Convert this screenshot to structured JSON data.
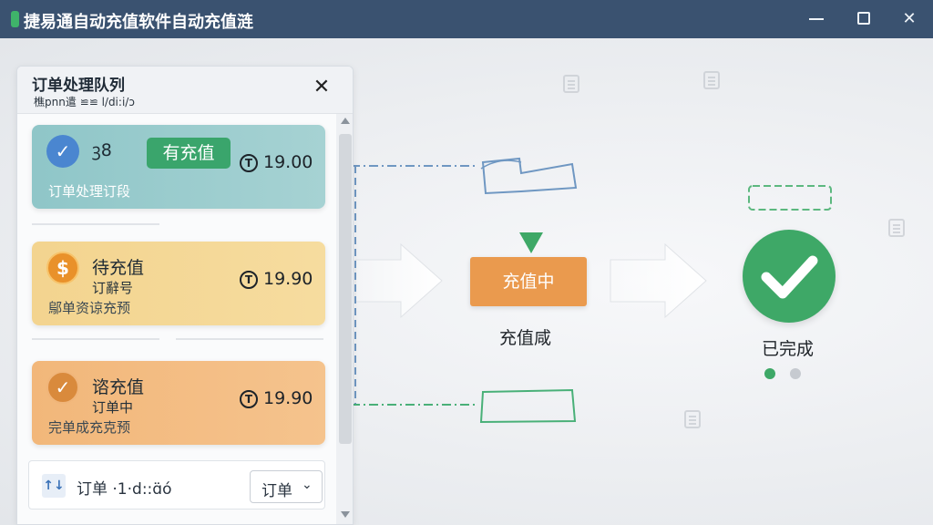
{
  "window": {
    "title": "捷易通自动充值软件自动充值涟",
    "controls": {
      "minimize": "minimize",
      "maximize": "maximize",
      "close": "close"
    }
  },
  "queue_panel": {
    "title": "订单处理队列",
    "subtitle": "樵pnn遣 ≌≌ l/di:i/ɔ",
    "close_glyph": "✕",
    "cards": [
      {
        "badge_icon": "check-icon",
        "badge_glyph": "✓",
        "line1": "ꝫ8",
        "status": "有充值",
        "amount": "19.00",
        "line3": "订单处理订段",
        "color": "#9ccdcf"
      },
      {
        "badge_icon": "dollar-icon",
        "badge_glyph": "$",
        "line1": "待充值",
        "line2": "订辭号",
        "amount": "19.90",
        "line3": "鄔单资谅充预",
        "color": "#f4d896"
      },
      {
        "badge_icon": "check-icon",
        "badge_glyph": "✓",
        "line1": "谘充值",
        "line2": "订单中",
        "amount": "19.90",
        "line3": "完单成充克预",
        "color": "#f3bd84"
      }
    ],
    "coin_glyph": "T",
    "footer": {
      "filter_icon": "sort-icon",
      "filter_glyph": "↑↓",
      "text": "订单 ·1·d::ɑ̈ó",
      "dropdown_label": "订单",
      "chevron": "⌄"
    }
  },
  "flow": {
    "stage_label": "充值中",
    "stage_caption": "充值咸",
    "done_caption": "已完成",
    "colors": {
      "stage": "#ea9a4e",
      "done": "#3ea867",
      "dash_blue": "#6f97c2",
      "dash_green": "#49b078"
    }
  }
}
